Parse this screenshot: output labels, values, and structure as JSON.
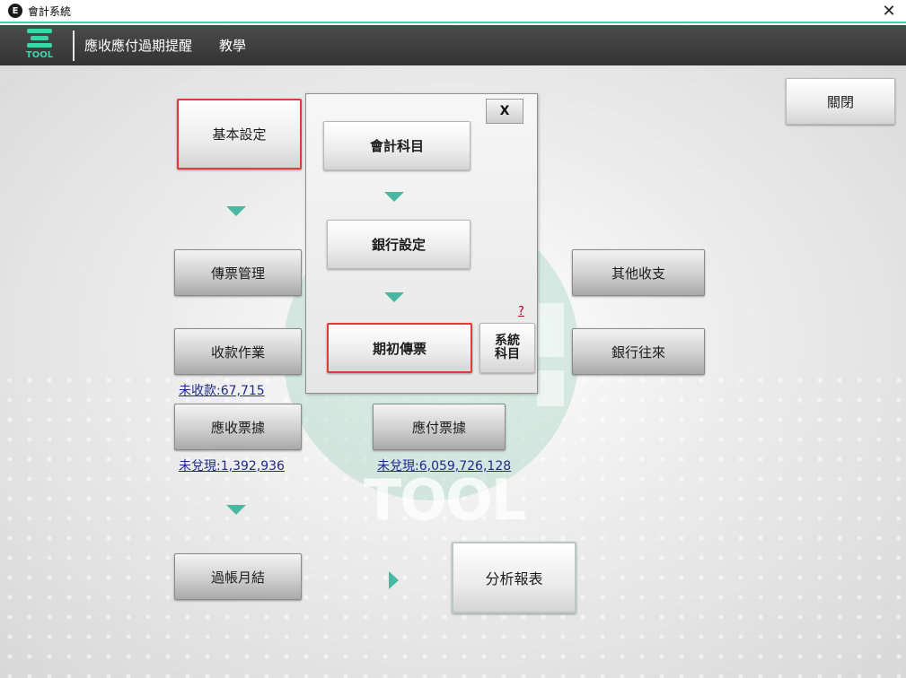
{
  "window": {
    "title": "會計系統",
    "icon_letter": "E",
    "close_glyph": "✕"
  },
  "header": {
    "logo_text": "TOOL",
    "nav": [
      "應收應付過期提醒",
      "教學"
    ]
  },
  "main": {
    "basic_settings": "基本設定",
    "voucher_management": "傳票管理",
    "receipt_operations": "收款作業",
    "uncollected_link": "未收款:67,715",
    "notes_receivable": "應收票據",
    "notes_receivable_link": "未兌現:1,392,936",
    "notes_payable": "應付票據",
    "notes_payable_link": "未兌現:6,059,726,128",
    "month_end_closing": "過帳月結",
    "analysis_report": "分析報表",
    "other_income_expense": "其他收支",
    "bank_transactions": "銀行往來",
    "close_button": "關閉",
    "watermark_text": "TOOL"
  },
  "popup": {
    "close_label": "X",
    "accounting_subjects": "會計科目",
    "bank_settings": "銀行設定",
    "opening_vouchers": "期初傳票",
    "system_subjects_line1": "系統",
    "system_subjects_line2": "科目",
    "help_label": "?"
  },
  "colors": {
    "accent": "#3fd4a8",
    "arrow": "#48b9a0",
    "highlight": "#e53935",
    "link": "#1f2a8f"
  }
}
